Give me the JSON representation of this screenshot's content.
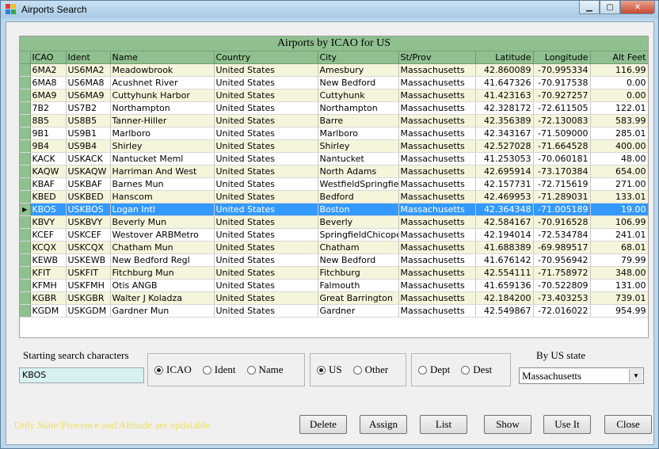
{
  "window": {
    "title": "Airports Search"
  },
  "grid": {
    "caption": "Airports by ICAO for US",
    "columns": [
      "ICAO",
      "Ident",
      "Name",
      "Country",
      "City",
      "St/Prov",
      "Latitude",
      "Longitude",
      "Alt Feet"
    ],
    "selected_index": 11,
    "rows": [
      [
        "6MA2",
        "US6MA2",
        "Meadowbrook",
        "United States",
        "Amesbury",
        "Massachusetts",
        "42.860089",
        "-70.995334",
        "116.99"
      ],
      [
        "6MA8",
        "US6MA8",
        "Acushnet River",
        "United States",
        "New Bedford",
        "Massachusetts",
        "41.647326",
        "-70.917538",
        "0.00"
      ],
      [
        "6MA9",
        "US6MA9",
        "Cuttyhunk Harbor",
        "United States",
        "Cuttyhunk",
        "Massachusetts",
        "41.423163",
        "-70.927257",
        "0.00"
      ],
      [
        "7B2",
        "US7B2",
        "Northampton",
        "United States",
        "Northampton",
        "Massachusetts",
        "42.328172",
        "-72.611505",
        "122.01"
      ],
      [
        "8B5",
        "US8B5",
        "Tanner-Hiller",
        "United States",
        "Barre",
        "Massachusetts",
        "42.356389",
        "-72.130083",
        "583.99"
      ],
      [
        "9B1",
        "US9B1",
        "Marlboro",
        "United States",
        "Marlboro",
        "Massachusetts",
        "42.343167",
        "-71.509000",
        "285.01"
      ],
      [
        "9B4",
        "US9B4",
        "Shirley",
        "United States",
        "Shirley",
        "Massachusetts",
        "42.527028",
        "-71.664528",
        "400.00"
      ],
      [
        "KACK",
        "USKACK",
        "Nantucket Meml",
        "United States",
        "Nantucket",
        "Massachusetts",
        "41.253053",
        "-70.060181",
        "48.00"
      ],
      [
        "KAQW",
        "USKAQW",
        "Harriman And West",
        "United States",
        "North Adams",
        "Massachusetts",
        "42.695914",
        "-73.170384",
        "654.00"
      ],
      [
        "KBAF",
        "USKBAF",
        "Barnes Mun",
        "United States",
        "WestfieldSpringfiel",
        "Massachusetts",
        "42.157731",
        "-72.715619",
        "271.00"
      ],
      [
        "KBED",
        "USKBED",
        "Hanscom",
        "United States",
        "Bedford",
        "Massachusetts",
        "42.469953",
        "-71.289031",
        "133.01"
      ],
      [
        "KBOS",
        "USKBOS",
        "Logan Intl",
        "United States",
        "Boston",
        "Massachusetts",
        "42.364348",
        "-71.005189",
        "19.00"
      ],
      [
        "KBVY",
        "USKBVY",
        "Beverly Mun",
        "United States",
        "Beverly",
        "Massachusetts",
        "42.584167",
        "-70.916528",
        "106.99"
      ],
      [
        "KCEF",
        "USKCEF",
        "Westover ARBMetro",
        "United States",
        "SpringfieldChicope",
        "Massachusetts",
        "42.194014",
        "-72.534784",
        "241.01"
      ],
      [
        "KCQX",
        "USKCQX",
        "Chatham Mun",
        "United States",
        "Chatham",
        "Massachusetts",
        "41.688389",
        "-69.989517",
        "68.01"
      ],
      [
        "KEWB",
        "USKEWB",
        "New Bedford Regl",
        "United States",
        "New Bedford",
        "Massachusetts",
        "41.676142",
        "-70.956942",
        "79.99"
      ],
      [
        "KFIT",
        "USKFIT",
        "Fitchburg Mun",
        "United States",
        "Fitchburg",
        "Massachusetts",
        "42.554111",
        "-71.758972",
        "348.00"
      ],
      [
        "KFMH",
        "USKFMH",
        "Otis ANGB",
        "United States",
        "Falmouth",
        "Massachusetts",
        "41.659136",
        "-70.522809",
        "131.00"
      ],
      [
        "KGBR",
        "USKGBR",
        "Walter J Koladza",
        "United States",
        "Great Barrington",
        "Massachusetts",
        "42.184200",
        "-73.403253",
        "739.01"
      ],
      [
        "KGDM",
        "USKGDM",
        "Gardner Mun",
        "United States",
        "Gardner",
        "Massachusetts",
        "42.549867",
        "-72.016022",
        "954.99"
      ]
    ]
  },
  "search": {
    "label": "Starting search characters",
    "value": "KBOS"
  },
  "group_key": {
    "options": [
      "ICAO",
      "Ident",
      "Name"
    ],
    "selected": "ICAO"
  },
  "group_region": {
    "options": [
      "US",
      "Other"
    ],
    "selected": "US"
  },
  "group_sort": {
    "options": [
      "Dept",
      "Dest"
    ],
    "selected": ""
  },
  "state": {
    "label": "By US state",
    "value": "Massachusetts"
  },
  "status": "Only State/Provence and Altitude are updatable.",
  "buttons": {
    "delete": "Delete",
    "assign": "Assign",
    "list": "List",
    "show": "Show",
    "use_it": "Use It",
    "close": "Close"
  },
  "icons": {
    "app": "airport-app-icon",
    "row_pointer": "row-pointer-icon",
    "dropdown": "chevron-down-icon"
  }
}
